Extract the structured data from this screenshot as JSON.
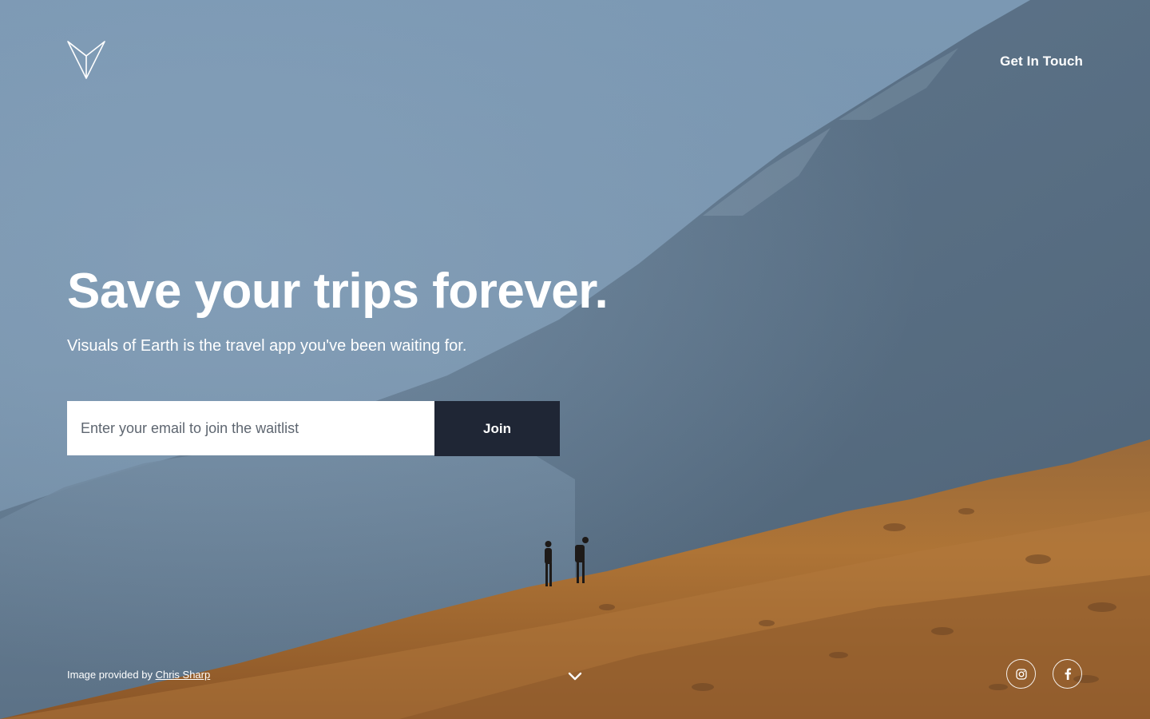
{
  "brand": {
    "logo_icon": "paper-plane-v-icon"
  },
  "nav": {
    "get_in_touch_label": "Get In Touch"
  },
  "hero": {
    "headline": "Save your trips forever.",
    "subheadline": "Visuals of Earth is the travel app you've been waiting for."
  },
  "signup": {
    "email_placeholder": "Enter your email to join the waitlist",
    "email_value": "",
    "join_label": "Join"
  },
  "footer": {
    "credit_prefix": "Image provided by ",
    "credit_author": "Chris Sharp",
    "scroll_icon": "chevron-down-icon",
    "social": [
      {
        "icon": "instagram-icon"
      },
      {
        "icon": "facebook-icon"
      }
    ]
  },
  "colors": {
    "sky": "#7d9bb6",
    "mountain": "#52677c",
    "hillside": "#a86d33",
    "button_bg": "#1f2635",
    "text": "#ffffff"
  }
}
